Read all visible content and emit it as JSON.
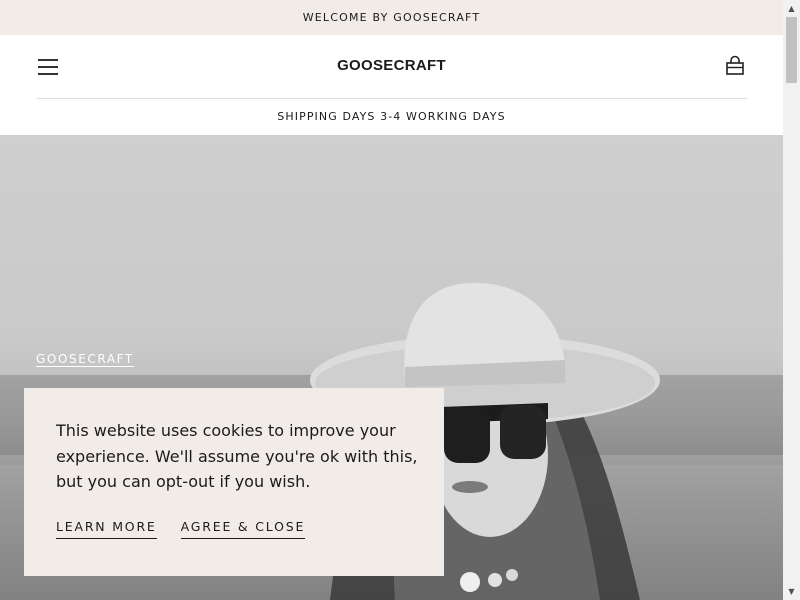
{
  "announcement": {
    "text": "WELCOME BY GOOSECRAFT"
  },
  "header": {
    "logo_text": "GOOSECRAFT",
    "menu_icon": "hamburger-menu-icon",
    "cart_icon": "shopping-bag-icon"
  },
  "shipping_bar": {
    "text": "SHIPPING DAYS 3-4 WORKING DAYS"
  },
  "hero": {
    "eyebrow": "GOOSECRAFT",
    "image": "black-and-white photo of woman in wide-brim hat and sunglasses"
  },
  "cookie_banner": {
    "message": "This website uses cookies to improve your experience. We'll assume you're ok with this, but you can opt-out if you wish.",
    "learn_more": "LEARN MORE",
    "agree": "AGREE & CLOSE"
  },
  "colors": {
    "banner_bg": "#f1ece8",
    "text": "#1c1b1b",
    "divider": "#dcdcdc"
  }
}
